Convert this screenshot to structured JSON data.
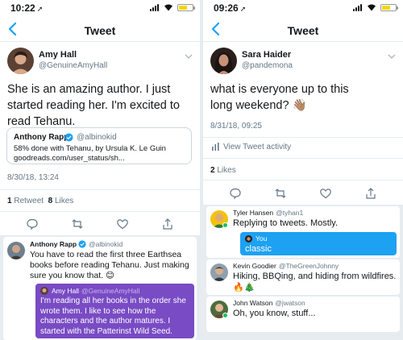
{
  "left": {
    "status_time": "10:22",
    "nav_title": "Tweet",
    "author_name": "Amy Hall",
    "author_handle": "@GenuineAmyHall",
    "tweet_text": "She is an amazing author. I just started reading her.  I'm excited to read Tehanu.",
    "quote": {
      "name": "Anthony Rapp",
      "handle": "@albinokid",
      "line1": "58% done with Tehanu, by Ursula K. Le Guin",
      "line2": "goodreads.com/user_status/sh..."
    },
    "timestamp": "8/30/18, 13:24",
    "retweet_count": "1",
    "retweet_label": "Retweet",
    "like_count": "8",
    "like_label": "Likes",
    "reply": {
      "name": "Anthony Rapp",
      "handle": "@albinokid",
      "text": "You have to read the first three Earthsea books before reading Tehanu. Just making sure you know that. 😊",
      "nested_name": "Amy Hall",
      "nested_handle": "@GenuineAmyHall",
      "nested_text": "I'm reading all her books in the order she wrote them.  I like to see how the characters and the author matures.  I started with the Patterinst Wild Seed."
    }
  },
  "right": {
    "status_time": "09:26",
    "nav_title": "Tweet",
    "author_name": "Sara Haider",
    "author_handle": "@pandemona",
    "tweet_text": "what is everyone up to this long weekend? 👋🏽",
    "timestamp": "8/31/18, 09:25",
    "activity_label": "View Tweet activity",
    "like_count": "2",
    "like_label": "Likes",
    "replies": [
      {
        "name": "Tyler Hansen",
        "handle": "@tyhan1",
        "text": "Replying to tweets. Mostly."
      },
      {
        "name": "You",
        "text": "classic"
      },
      {
        "name": "Kevin Goodier",
        "handle": "@TheGreenJohnny",
        "text": "Hiking, BBQing, and hiding from wildfires.",
        "emoji": "🔥🎄"
      },
      {
        "name": "John Watson",
        "handle": "@jwatson",
        "text": "Oh, you know, stuff..."
      }
    ]
  },
  "colors": {
    "accent": "#1da1f2",
    "purple": "#794bc4",
    "muted": "#657786",
    "border": "#e6ecf0",
    "online": "#17bf63"
  },
  "icons": [
    "location-arrow-icon",
    "signal-icon",
    "wifi-icon",
    "battery-icon",
    "back-chevron-icon",
    "caret-down-icon",
    "verified-icon",
    "reply-icon",
    "retweet-icon",
    "heart-icon",
    "share-icon",
    "activity-icon"
  ]
}
